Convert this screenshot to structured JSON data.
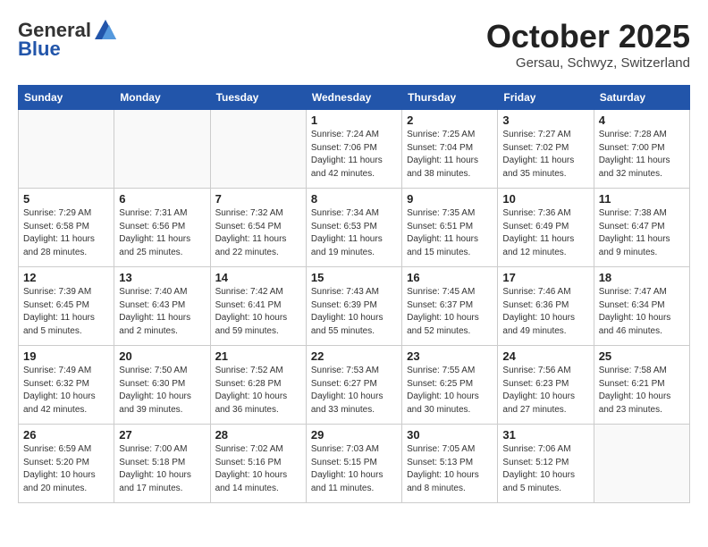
{
  "header": {
    "logo_general": "General",
    "logo_blue": "Blue",
    "month": "October 2025",
    "location": "Gersau, Schwyz, Switzerland"
  },
  "weekdays": [
    "Sunday",
    "Monday",
    "Tuesday",
    "Wednesday",
    "Thursday",
    "Friday",
    "Saturday"
  ],
  "weeks": [
    [
      {
        "day": "",
        "info": ""
      },
      {
        "day": "",
        "info": ""
      },
      {
        "day": "",
        "info": ""
      },
      {
        "day": "1",
        "info": "Sunrise: 7:24 AM\nSunset: 7:06 PM\nDaylight: 11 hours\nand 42 minutes."
      },
      {
        "day": "2",
        "info": "Sunrise: 7:25 AM\nSunset: 7:04 PM\nDaylight: 11 hours\nand 38 minutes."
      },
      {
        "day": "3",
        "info": "Sunrise: 7:27 AM\nSunset: 7:02 PM\nDaylight: 11 hours\nand 35 minutes."
      },
      {
        "day": "4",
        "info": "Sunrise: 7:28 AM\nSunset: 7:00 PM\nDaylight: 11 hours\nand 32 minutes."
      }
    ],
    [
      {
        "day": "5",
        "info": "Sunrise: 7:29 AM\nSunset: 6:58 PM\nDaylight: 11 hours\nand 28 minutes."
      },
      {
        "day": "6",
        "info": "Sunrise: 7:31 AM\nSunset: 6:56 PM\nDaylight: 11 hours\nand 25 minutes."
      },
      {
        "day": "7",
        "info": "Sunrise: 7:32 AM\nSunset: 6:54 PM\nDaylight: 11 hours\nand 22 minutes."
      },
      {
        "day": "8",
        "info": "Sunrise: 7:34 AM\nSunset: 6:53 PM\nDaylight: 11 hours\nand 19 minutes."
      },
      {
        "day": "9",
        "info": "Sunrise: 7:35 AM\nSunset: 6:51 PM\nDaylight: 11 hours\nand 15 minutes."
      },
      {
        "day": "10",
        "info": "Sunrise: 7:36 AM\nSunset: 6:49 PM\nDaylight: 11 hours\nand 12 minutes."
      },
      {
        "day": "11",
        "info": "Sunrise: 7:38 AM\nSunset: 6:47 PM\nDaylight: 11 hours\nand 9 minutes."
      }
    ],
    [
      {
        "day": "12",
        "info": "Sunrise: 7:39 AM\nSunset: 6:45 PM\nDaylight: 11 hours\nand 5 minutes."
      },
      {
        "day": "13",
        "info": "Sunrise: 7:40 AM\nSunset: 6:43 PM\nDaylight: 11 hours\nand 2 minutes."
      },
      {
        "day": "14",
        "info": "Sunrise: 7:42 AM\nSunset: 6:41 PM\nDaylight: 10 hours\nand 59 minutes."
      },
      {
        "day": "15",
        "info": "Sunrise: 7:43 AM\nSunset: 6:39 PM\nDaylight: 10 hours\nand 55 minutes."
      },
      {
        "day": "16",
        "info": "Sunrise: 7:45 AM\nSunset: 6:37 PM\nDaylight: 10 hours\nand 52 minutes."
      },
      {
        "day": "17",
        "info": "Sunrise: 7:46 AM\nSunset: 6:36 PM\nDaylight: 10 hours\nand 49 minutes."
      },
      {
        "day": "18",
        "info": "Sunrise: 7:47 AM\nSunset: 6:34 PM\nDaylight: 10 hours\nand 46 minutes."
      }
    ],
    [
      {
        "day": "19",
        "info": "Sunrise: 7:49 AM\nSunset: 6:32 PM\nDaylight: 10 hours\nand 42 minutes."
      },
      {
        "day": "20",
        "info": "Sunrise: 7:50 AM\nSunset: 6:30 PM\nDaylight: 10 hours\nand 39 minutes."
      },
      {
        "day": "21",
        "info": "Sunrise: 7:52 AM\nSunset: 6:28 PM\nDaylight: 10 hours\nand 36 minutes."
      },
      {
        "day": "22",
        "info": "Sunrise: 7:53 AM\nSunset: 6:27 PM\nDaylight: 10 hours\nand 33 minutes."
      },
      {
        "day": "23",
        "info": "Sunrise: 7:55 AM\nSunset: 6:25 PM\nDaylight: 10 hours\nand 30 minutes."
      },
      {
        "day": "24",
        "info": "Sunrise: 7:56 AM\nSunset: 6:23 PM\nDaylight: 10 hours\nand 27 minutes."
      },
      {
        "day": "25",
        "info": "Sunrise: 7:58 AM\nSunset: 6:21 PM\nDaylight: 10 hours\nand 23 minutes."
      }
    ],
    [
      {
        "day": "26",
        "info": "Sunrise: 6:59 AM\nSunset: 5:20 PM\nDaylight: 10 hours\nand 20 minutes."
      },
      {
        "day": "27",
        "info": "Sunrise: 7:00 AM\nSunset: 5:18 PM\nDaylight: 10 hours\nand 17 minutes."
      },
      {
        "day": "28",
        "info": "Sunrise: 7:02 AM\nSunset: 5:16 PM\nDaylight: 10 hours\nand 14 minutes."
      },
      {
        "day": "29",
        "info": "Sunrise: 7:03 AM\nSunset: 5:15 PM\nDaylight: 10 hours\nand 11 minutes."
      },
      {
        "day": "30",
        "info": "Sunrise: 7:05 AM\nSunset: 5:13 PM\nDaylight: 10 hours\nand 8 minutes."
      },
      {
        "day": "31",
        "info": "Sunrise: 7:06 AM\nSunset: 5:12 PM\nDaylight: 10 hours\nand 5 minutes."
      },
      {
        "day": "",
        "info": ""
      }
    ]
  ]
}
